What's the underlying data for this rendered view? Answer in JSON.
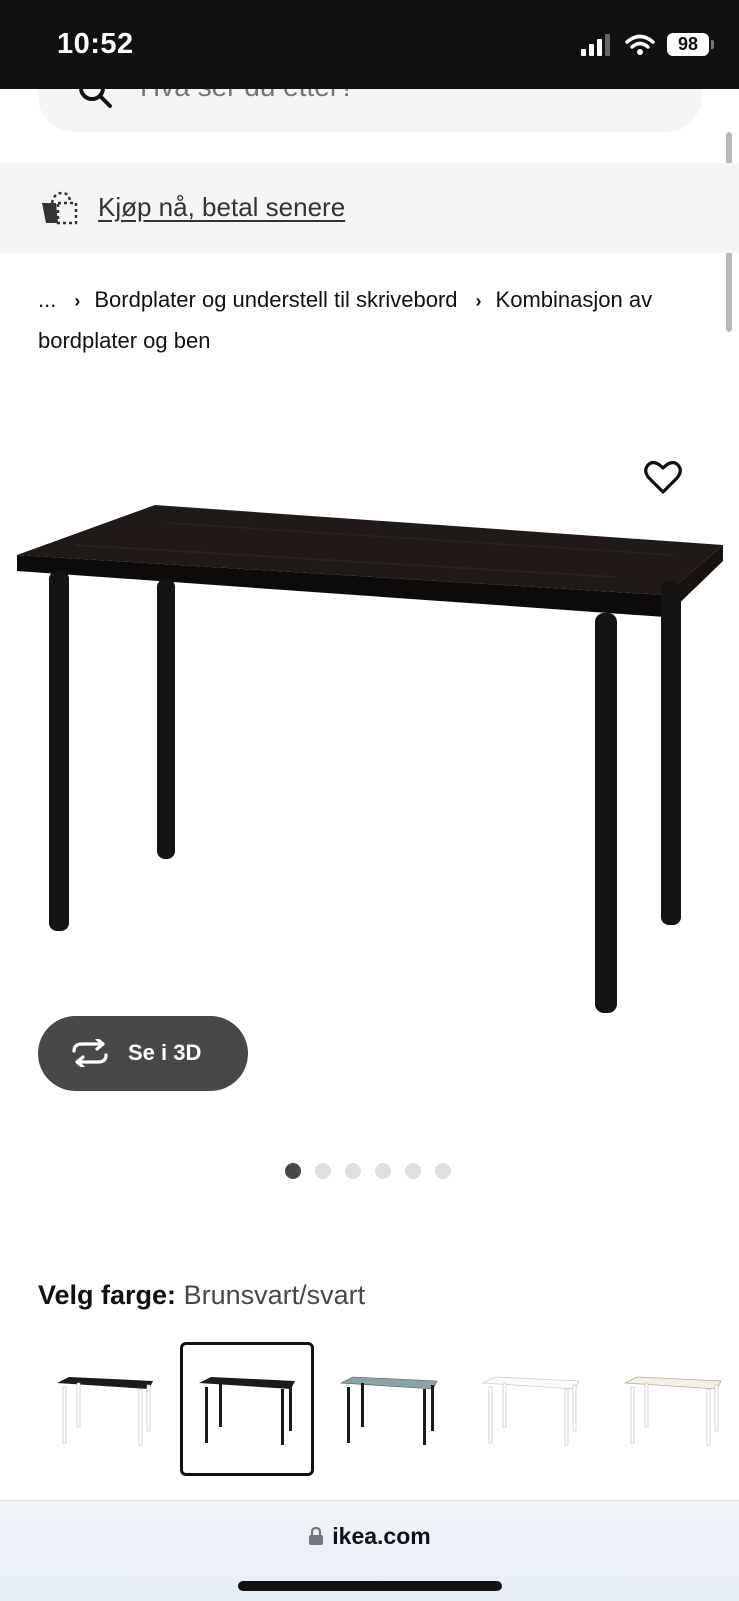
{
  "status_bar": {
    "time": "10:52",
    "battery": "98"
  },
  "search": {
    "placeholder": "Hva ser du etter?"
  },
  "banner": {
    "link_text": "Kjøp nå, betal senere",
    "icon": "bag-icon"
  },
  "breadcrumb": {
    "ellipsis": "...",
    "items": [
      "Bordplater og understell til skrivebord",
      "Kombinasjon av bordplater og ben"
    ]
  },
  "product": {
    "favorite_icon": "heart-icon",
    "image": "black-desk-image"
  },
  "view_3d": {
    "label": "Se i 3D",
    "icon": "rotate-3d-icon"
  },
  "carousel": {
    "count": 6,
    "active_index": 0
  },
  "color_select": {
    "label": "Velg farge:",
    "value": "Brunsvart/svart",
    "options": [
      {
        "top": "#1e1a18",
        "legs": "#ffffff",
        "selected": false
      },
      {
        "top": "#1e1a18",
        "legs": "#1a1a1a",
        "selected": true
      },
      {
        "top": "#8aa4a6",
        "legs": "#1a1a1a",
        "selected": false
      },
      {
        "top": "#fafafa",
        "legs": "#ffffff",
        "selected": false
      },
      {
        "top": "#f4f0e8",
        "legs": "#ffffff",
        "selected": false
      }
    ]
  },
  "browser": {
    "url": "ikea.com"
  }
}
